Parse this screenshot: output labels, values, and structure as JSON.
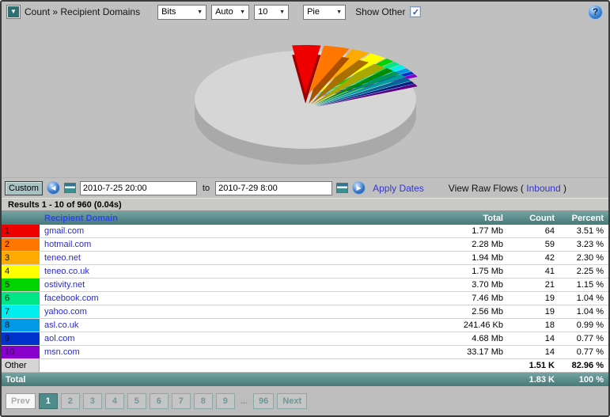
{
  "toolbar": {
    "title": "Count » Recipient Domains",
    "unit_select": "Bits",
    "interval_select": "Auto",
    "top_n_select": "10",
    "chart_type_select": "Pie",
    "show_other_label": "Show Other",
    "show_other_checked": true,
    "help_icon": "?",
    "menu_icon": "▼"
  },
  "date_controls": {
    "custom_label": "Custom",
    "prev_icon": "◀",
    "next_icon": "▶",
    "from_value": "2010-7-25 20:00",
    "to_label": "to",
    "to_value": "2010-7-29 8:00",
    "apply_label": "Apply Dates",
    "view_raw_prefix": "View Raw Flows ( ",
    "view_raw_link": "Inbound",
    "view_raw_suffix": " )"
  },
  "results_bar": {
    "text": "Results 1 - 10 of 960 (0.04s)"
  },
  "table": {
    "headers": {
      "domain": "Recipient Domain",
      "total": "Total",
      "count": "Count",
      "percent": "Percent"
    },
    "rows": [
      {
        "rank": "1",
        "color": "#ee0000",
        "domain": "gmail.com",
        "total": "1.77 Mb",
        "count": "64",
        "percent": "3.51 %"
      },
      {
        "rank": "2",
        "color": "#ff7700",
        "domain": "hotmail.com",
        "total": "2.28 Mb",
        "count": "59",
        "percent": "3.23 %"
      },
      {
        "rank": "3",
        "color": "#ffaa00",
        "domain": "teneo.net",
        "total": "1.94 Mb",
        "count": "42",
        "percent": "2.30 %"
      },
      {
        "rank": "4",
        "color": "#ffff00",
        "domain": "teneo.co.uk",
        "total": "1.75 Mb",
        "count": "41",
        "percent": "2.25 %"
      },
      {
        "rank": "5",
        "color": "#00d400",
        "domain": "ostivity.net",
        "total": "3.70 Mb",
        "count": "21",
        "percent": "1.15 %"
      },
      {
        "rank": "6",
        "color": "#00e687",
        "domain": "facebook.com",
        "total": "7.46 Mb",
        "count": "19",
        "percent": "1.04 %"
      },
      {
        "rank": "7",
        "color": "#00eeee",
        "domain": "yahoo.com",
        "total": "2.56 Mb",
        "count": "19",
        "percent": "1.04 %"
      },
      {
        "rank": "8",
        "color": "#0099e6",
        "domain": "asl.co.uk",
        "total": "241.46 Kb",
        "count": "18",
        "percent": "0.99 %"
      },
      {
        "rank": "9",
        "color": "#0033cc",
        "domain": "aol.com",
        "total": "4.68 Mb",
        "count": "14",
        "percent": "0.77 %"
      },
      {
        "rank": "10",
        "color": "#8800cc",
        "domain": "msn.com",
        "total": "33.17 Mb",
        "count": "14",
        "percent": "0.77 %"
      }
    ],
    "other_row": {
      "label": "Other",
      "total": "",
      "count": "1.51 K",
      "percent": "82.96 %"
    },
    "total_row": {
      "label": "Total",
      "total": "",
      "count": "1.83 K",
      "percent": "100 %"
    }
  },
  "pagination": {
    "prev": "Prev",
    "pages": [
      "1",
      "2",
      "3",
      "4",
      "5",
      "6",
      "7",
      "8",
      "9"
    ],
    "active": "1",
    "ellipsis": "...",
    "last_page": "96",
    "next": "Next"
  },
  "chart_data": {
    "type": "pie",
    "style": "3d-exploded",
    "title": "",
    "legend": false,
    "labels": [
      "gmail.com",
      "hotmail.com",
      "teneo.net",
      "teneo.co.uk",
      "ostivity.net",
      "facebook.com",
      "yahoo.com",
      "asl.co.uk",
      "aol.com",
      "msn.com",
      "Other"
    ],
    "values": [
      3.51,
      3.23,
      2.3,
      2.25,
      1.15,
      1.04,
      1.04,
      0.99,
      0.77,
      0.77,
      82.96
    ],
    "colors": [
      "#ee0000",
      "#ff7700",
      "#ffaa00",
      "#ffff00",
      "#00d400",
      "#00e687",
      "#00eeee",
      "#0099e6",
      "#0033cc",
      "#8800cc",
      "#d6d6d6"
    ],
    "other_top_color": "#d6d6d6",
    "other_side_color": "#a9a9a9"
  }
}
